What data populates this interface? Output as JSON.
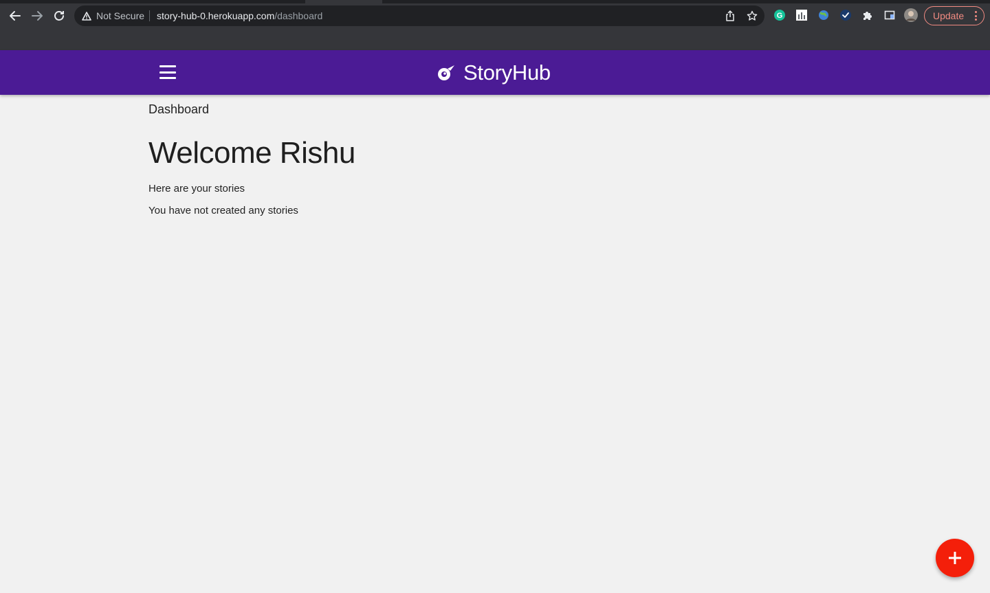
{
  "browser": {
    "security_label": "Not Secure",
    "url_host": "story-hub-0.herokuapp.com",
    "url_path": "/dashboard",
    "update_label": "Update",
    "extensions": [
      "grammarly-icon",
      "bar-chart-icon",
      "globe-icon",
      "check-icon",
      "puzzle-icon",
      "sidebar-icon",
      "profile-avatar"
    ]
  },
  "navbar": {
    "brand": "StoryHub",
    "brand_color": "#4b1b95"
  },
  "main": {
    "breadcrumb": "Dashboard",
    "welcome": "Welcome Rishu",
    "subtitle": "Here are your stories",
    "empty_message": "You have not created any stories"
  },
  "fab": {
    "icon": "plus-icon",
    "color": "#f41f0a"
  }
}
